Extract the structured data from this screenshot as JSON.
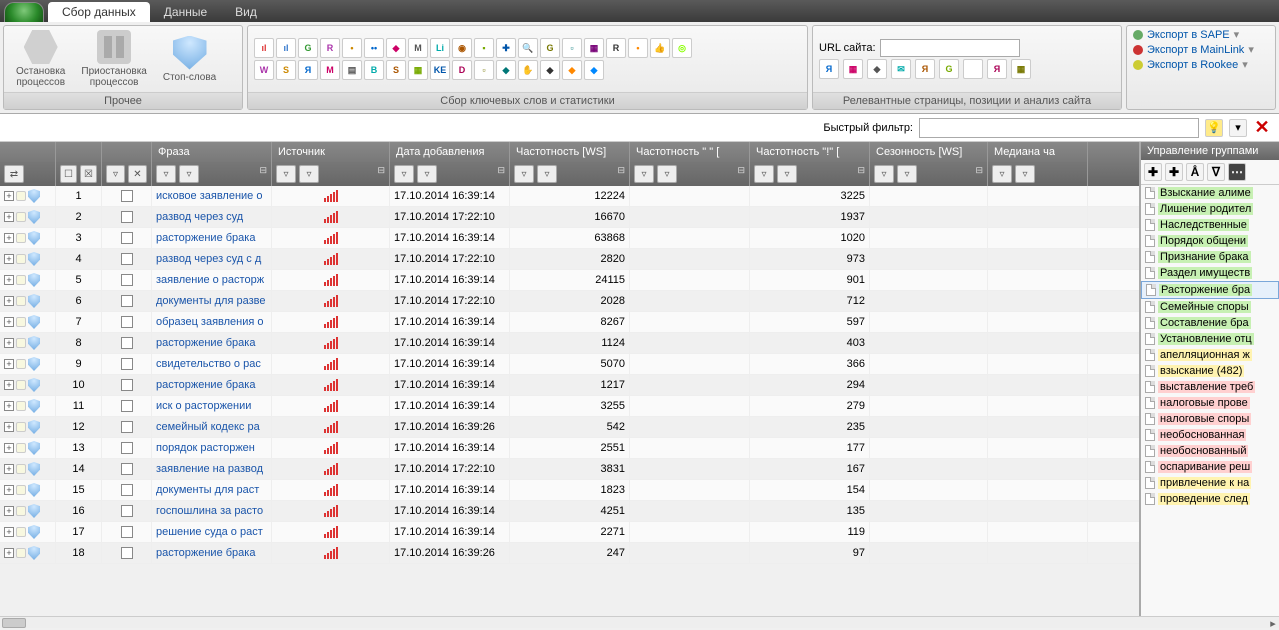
{
  "tabs": [
    "Сбор данных",
    "Данные",
    "Вид"
  ],
  "ribbon": {
    "group1": {
      "label": "Прочее",
      "btn1": "Остановка\nпроцессов",
      "btn2": "Приостановка\nпроцессов",
      "btn3": "Стоп-слова"
    },
    "group2": {
      "label": "Сбор ключевых слов и статистики"
    },
    "group3": {
      "label": "Релевантные страницы, позиции и анализ сайта",
      "url_label": "URL сайта:"
    },
    "exports": {
      "sape": "Экспорт в SAPE",
      "mainlink": "Экспорт в MainLink",
      "rookee": "Экспорт в Rookee"
    }
  },
  "filter": {
    "label": "Быстрый фильтр:"
  },
  "columns": [
    "",
    "",
    "",
    "Фраза",
    "Источник",
    "Дата добавления",
    "Частотность [WS]",
    "Частотность \" \" [",
    "Частотность \"!\" [",
    "Сезонность [WS]",
    "Медиана ча"
  ],
  "rows": [
    {
      "n": 1,
      "phrase": "исковое заявление о",
      "date": "17.10.2014 16:39:14",
      "ws": "12224",
      "q": "",
      "e": "3225"
    },
    {
      "n": 2,
      "phrase": "развод через суд",
      "date": "17.10.2014 17:22:10",
      "ws": "16670",
      "q": "",
      "e": "1937"
    },
    {
      "n": 3,
      "phrase": "расторжение брака",
      "date": "17.10.2014 16:39:14",
      "ws": "63868",
      "q": "",
      "e": "1020"
    },
    {
      "n": 4,
      "phrase": "развод через суд с д",
      "date": "17.10.2014 17:22:10",
      "ws": "2820",
      "q": "",
      "e": "973"
    },
    {
      "n": 5,
      "phrase": "заявление о расторж",
      "date": "17.10.2014 16:39:14",
      "ws": "24115",
      "q": "",
      "e": "901"
    },
    {
      "n": 6,
      "phrase": "документы для разве",
      "date": "17.10.2014 17:22:10",
      "ws": "2028",
      "q": "",
      "e": "712"
    },
    {
      "n": 7,
      "phrase": "образец заявления о",
      "date": "17.10.2014 16:39:14",
      "ws": "8267",
      "q": "",
      "e": "597"
    },
    {
      "n": 8,
      "phrase": "расторжение брака",
      "date": "17.10.2014 16:39:14",
      "ws": "1124",
      "q": "",
      "e": "403"
    },
    {
      "n": 9,
      "phrase": "свидетельство о рас",
      "date": "17.10.2014 16:39:14",
      "ws": "5070",
      "q": "",
      "e": "366"
    },
    {
      "n": 10,
      "phrase": "расторжение брака",
      "date": "17.10.2014 16:39:14",
      "ws": "1217",
      "q": "",
      "e": "294"
    },
    {
      "n": 11,
      "phrase": "иск о расторжении",
      "date": "17.10.2014 16:39:14",
      "ws": "3255",
      "q": "",
      "e": "279"
    },
    {
      "n": 12,
      "phrase": "семейный кодекс ра",
      "date": "17.10.2014 16:39:26",
      "ws": "542",
      "q": "",
      "e": "235"
    },
    {
      "n": 13,
      "phrase": "порядок расторжен",
      "date": "17.10.2014 16:39:14",
      "ws": "2551",
      "q": "",
      "e": "177"
    },
    {
      "n": 14,
      "phrase": "заявление на развод",
      "date": "17.10.2014 17:22:10",
      "ws": "3831",
      "q": "",
      "e": "167"
    },
    {
      "n": 15,
      "phrase": "документы для раст",
      "date": "17.10.2014 16:39:14",
      "ws": "1823",
      "q": "",
      "e": "154"
    },
    {
      "n": 16,
      "phrase": "госпошлина за расто",
      "date": "17.10.2014 16:39:14",
      "ws": "4251",
      "q": "",
      "e": "135"
    },
    {
      "n": 17,
      "phrase": "решение суда о раст",
      "date": "17.10.2014 16:39:14",
      "ws": "2271",
      "q": "",
      "e": "119"
    },
    {
      "n": 18,
      "phrase": "расторжение брака",
      "date": "17.10.2014 16:39:26",
      "ws": "247",
      "q": "",
      "e": "97"
    }
  ],
  "side": {
    "title": "Управление группами",
    "groups": [
      {
        "t": "Взыскание алиме",
        "c": "g"
      },
      {
        "t": "Лишение родител",
        "c": "g"
      },
      {
        "t": "Наследственные",
        "c": "g"
      },
      {
        "t": "Порядок общени",
        "c": "g"
      },
      {
        "t": "Признание брака",
        "c": "g"
      },
      {
        "t": "Раздел имуществ",
        "c": "g"
      },
      {
        "t": "Расторжение бра",
        "c": "g",
        "sel": true
      },
      {
        "t": "Семейные споры",
        "c": "g"
      },
      {
        "t": "Составление бра",
        "c": "g"
      },
      {
        "t": "Установление отц",
        "c": "g"
      },
      {
        "t": "апелляционная ж",
        "c": "y"
      },
      {
        "t": "взыскание (482)",
        "c": "y"
      },
      {
        "t": "выставление треб",
        "c": "p"
      },
      {
        "t": "налоговые прове",
        "c": "p"
      },
      {
        "t": "налоговые споры",
        "c": "p"
      },
      {
        "t": "необоснованная",
        "c": "p"
      },
      {
        "t": "необоснованный",
        "c": "p"
      },
      {
        "t": "оспаривание реш",
        "c": "p"
      },
      {
        "t": "привлечение к на",
        "c": "y"
      },
      {
        "t": "проведение след",
        "c": "y"
      }
    ]
  }
}
